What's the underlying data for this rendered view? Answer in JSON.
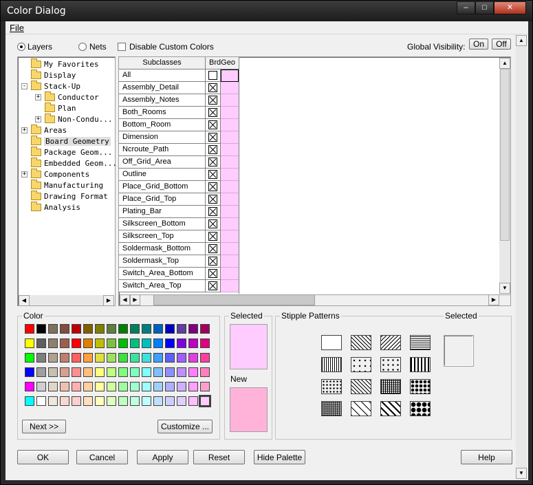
{
  "window": {
    "title": "Color Dialog"
  },
  "menu": {
    "file": "File"
  },
  "options": {
    "layers": "Layers",
    "nets": "Nets",
    "disable_custom": "Disable Custom Colors",
    "global_visibility": "Global Visibility:",
    "on": "On",
    "off": "Off"
  },
  "tree": [
    {
      "label": "My Favorites",
      "indent": 0,
      "expander": ""
    },
    {
      "label": "Display",
      "indent": 0,
      "expander": ""
    },
    {
      "label": "Stack-Up",
      "indent": 0,
      "expander": "-"
    },
    {
      "label": "Conductor",
      "indent": 1,
      "expander": "+"
    },
    {
      "label": "Plan",
      "indent": 1,
      "expander": ""
    },
    {
      "label": "Non-Condu...",
      "indent": 1,
      "expander": "+"
    },
    {
      "label": "Areas",
      "indent": 0,
      "expander": "+"
    },
    {
      "label": "Board Geometry",
      "indent": 0,
      "expander": "",
      "selected": true
    },
    {
      "label": "Package Geom...",
      "indent": 0,
      "expander": ""
    },
    {
      "label": "Embedded Geom...",
      "indent": 0,
      "expander": ""
    },
    {
      "label": "Components",
      "indent": 0,
      "expander": "+"
    },
    {
      "label": "Manufacturing",
      "indent": 0,
      "expander": ""
    },
    {
      "label": "Drawing Format",
      "indent": 0,
      "expander": ""
    },
    {
      "label": "Analysis",
      "indent": 0,
      "expander": ""
    }
  ],
  "grid": {
    "col_subclasses": "Subclasses",
    "col_brdgeo": "BrdGeo",
    "rows": [
      {
        "name": "All",
        "checked": false
      },
      {
        "name": "Assembly_Detail",
        "checked": true
      },
      {
        "name": "Assembly_Notes",
        "checked": true
      },
      {
        "name": "Both_Rooms",
        "checked": true
      },
      {
        "name": "Bottom_Room",
        "checked": true
      },
      {
        "name": "Dimension",
        "checked": true
      },
      {
        "name": "Ncroute_Path",
        "checked": true
      },
      {
        "name": "Off_Grid_Area",
        "checked": true
      },
      {
        "name": "Outline",
        "checked": true
      },
      {
        "name": "Place_Grid_Bottom",
        "checked": true
      },
      {
        "name": "Place_Grid_Top",
        "checked": true
      },
      {
        "name": "Plating_Bar",
        "checked": true
      },
      {
        "name": "Silkscreen_Bottom",
        "checked": true
      },
      {
        "name": "Silkscreen_Top",
        "checked": true
      },
      {
        "name": "Soldermask_Bottom",
        "checked": true
      },
      {
        "name": "Soldermask_Top",
        "checked": true
      },
      {
        "name": "Switch_Area_Bottom",
        "checked": true
      },
      {
        "name": "Switch_Area_Top",
        "checked": true
      }
    ]
  },
  "palette": {
    "title": "Color",
    "rows": [
      [
        "#ff0000",
        "#000000",
        "#7f6f5f",
        "#7f4f3f",
        "#bf0000",
        "#7f5f00",
        "#7f7f00",
        "#5f7f3f",
        "#007f00",
        "#007f5f",
        "#007f7f",
        "#005fbf",
        "#0000bf",
        "#5f3f9f",
        "#7f007f",
        "#9f005f"
      ],
      [
        "#ffff00",
        "#5f5f5f",
        "#8f7f6f",
        "#9f5f4f",
        "#ff0000",
        "#df7f00",
        "#bfbf00",
        "#7fbf3f",
        "#00bf00",
        "#00bf7f",
        "#00bfbf",
        "#007fff",
        "#0000ff",
        "#7f00df",
        "#bf00bf",
        "#df007f"
      ],
      [
        "#00ff00",
        "#7f7f7f",
        "#afa08f",
        "#bf7f6f",
        "#ff5f5f",
        "#ff9f3f",
        "#dfdf3f",
        "#9fdf5f",
        "#3fdf3f",
        "#3fdf9f",
        "#3fdfdf",
        "#3f9fff",
        "#5f5fff",
        "#9f5fff",
        "#df3fdf",
        "#ff3f9f"
      ],
      [
        "#0000ff",
        "#9f9f9f",
        "#c7bfaf",
        "#d79f8f",
        "#ff8f8f",
        "#ffbf7f",
        "#ffff7f",
        "#bfff7f",
        "#7fff7f",
        "#7fffbf",
        "#7fffff",
        "#7fbfff",
        "#8f8fff",
        "#bf8fff",
        "#ff7fff",
        "#ff7fbf"
      ],
      [
        "#ff00ff",
        "#cfcfcf",
        "#dfd7c7",
        "#efbfaf",
        "#ffafaf",
        "#ffcf9f",
        "#ffff9f",
        "#cfff9f",
        "#9fff9f",
        "#9fffcf",
        "#9fffff",
        "#9fcfff",
        "#afafff",
        "#cfafff",
        "#ff9fff",
        "#ff9fcf"
      ],
      [
        "#00ffff",
        "#ffffff",
        "#efe7df",
        "#f7d7cf",
        "#ffcfcf",
        "#ffdfbf",
        "#ffffbf",
        "#dfffbf",
        "#bfffbf",
        "#bfffdf",
        "#bfffff",
        "#bfdfff",
        "#cfcfff",
        "#dfcfff",
        "#ffbfff",
        "#ffbfdf"
      ]
    ]
  },
  "selected_panel": {
    "title": "Selected",
    "color": "#ffccff",
    "new_title": "New",
    "new_color": "#ffb3d9"
  },
  "stipple": {
    "title": "Stipple Patterns",
    "selected_title": "Selected"
  },
  "buttons": {
    "next": "Next >>",
    "customize": "Customize ...",
    "ok": "OK",
    "cancel": "Cancel",
    "apply": "Apply",
    "reset": "Reset",
    "hide_palette": "Hide Palette",
    "help": "Help"
  }
}
